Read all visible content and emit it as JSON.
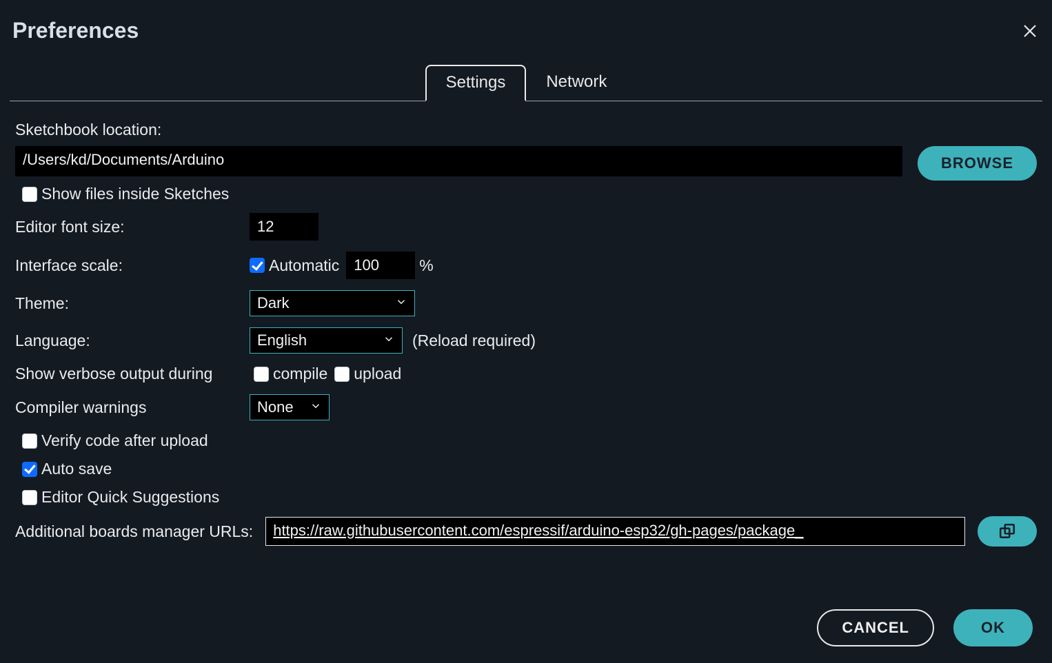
{
  "dialog": {
    "title": "Preferences"
  },
  "tabs": {
    "settings": "Settings",
    "network": "Network"
  },
  "labels": {
    "sketchbook": "Sketchbook location:",
    "show_files": "Show files inside Sketches",
    "font_size": "Editor font size:",
    "interface_scale": "Interface scale:",
    "automatic": "Automatic",
    "percent": "%",
    "theme": "Theme:",
    "language": "Language:",
    "reload_required": "(Reload required)",
    "verbose": "Show verbose output during",
    "compile": "compile",
    "upload": "upload",
    "compiler_warnings": "Compiler warnings",
    "verify_after_upload": "Verify code after upload",
    "auto_save": "Auto save",
    "quick_suggestions": "Editor Quick Suggestions",
    "boards_urls": "Additional boards manager URLs:"
  },
  "values": {
    "sketchbook_path": "/Users/kd/Documents/Arduino",
    "font_size": "12",
    "scale": "100",
    "theme": "Dark",
    "language": "English",
    "compiler_warnings": "None",
    "boards_url": "https://raw.githubusercontent.com/espressif/arduino-esp32/gh-pages/package_"
  },
  "buttons": {
    "browse": "BROWSE",
    "cancel": "CANCEL",
    "ok": "OK"
  }
}
